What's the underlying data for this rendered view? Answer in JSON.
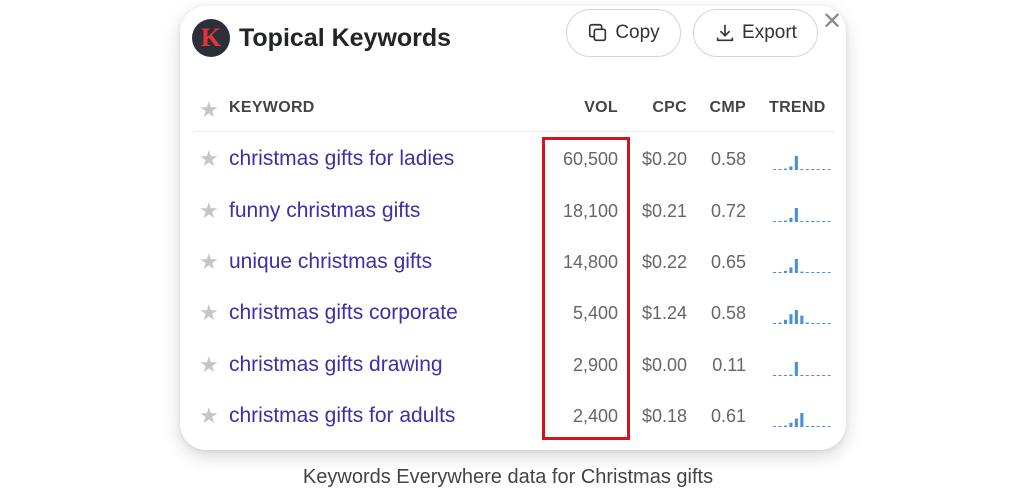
{
  "panel": {
    "logo_letter": "K",
    "title": "Topical Keywords",
    "copy_label": "Copy",
    "export_label": "Export",
    "close_glyph": "✕"
  },
  "table": {
    "columns": [
      "KEYWORD",
      "VOL",
      "CPC",
      "CMP",
      "TREND"
    ],
    "rows": [
      {
        "keyword": "christmas gifts for ladies",
        "vol": "60,500",
        "cpc": "$0.20",
        "cmp": "0.58",
        "trend": [
          0,
          0,
          0.1,
          0.25,
          1,
          0.05,
          0,
          0,
          0,
          0,
          0
        ]
      },
      {
        "keyword": "funny christmas gifts",
        "vol": "18,100",
        "cpc": "$0.21",
        "cmp": "0.72",
        "trend": [
          0,
          0,
          0.1,
          0.3,
          1,
          0.05,
          0,
          0,
          0,
          0,
          0
        ]
      },
      {
        "keyword": "unique christmas gifts",
        "vol": "14,800",
        "cpc": "$0.22",
        "cmp": "0.65",
        "trend": [
          0,
          0,
          0.15,
          0.4,
          1,
          0.1,
          0,
          0,
          0,
          0,
          0
        ]
      },
      {
        "keyword": "christmas gifts corporate",
        "vol": "5,400",
        "cpc": "$1.24",
        "cmp": "0.58",
        "trend": [
          0,
          0.1,
          0.3,
          0.7,
          1,
          0.6,
          0.1,
          0,
          0,
          0,
          0
        ]
      },
      {
        "keyword": "christmas gifts drawing",
        "vol": "2,900",
        "cpc": "$0.00",
        "cmp": "0.11",
        "trend": [
          0,
          0,
          0,
          0.1,
          1,
          0,
          0,
          0,
          0,
          0,
          0
        ]
      },
      {
        "keyword": "christmas gifts for adults",
        "vol": "2,400",
        "cpc": "$0.18",
        "cmp": "0.61",
        "trend": [
          0,
          0,
          0.1,
          0.3,
          0.6,
          1,
          0.05,
          0,
          0,
          0,
          0
        ]
      }
    ]
  },
  "caption": "Keywords Everywhere data for Christmas gifts",
  "colors": {
    "keyword_link": "#3b30a8",
    "trend_bar": "#4a90d9",
    "highlight_box": "#d4141c",
    "logo_bg": "#2c2f3a",
    "logo_letter": "#e5333a"
  },
  "icons": {
    "copy": "copy-icon",
    "export": "download-icon",
    "close": "close-icon",
    "star": "star-icon"
  }
}
